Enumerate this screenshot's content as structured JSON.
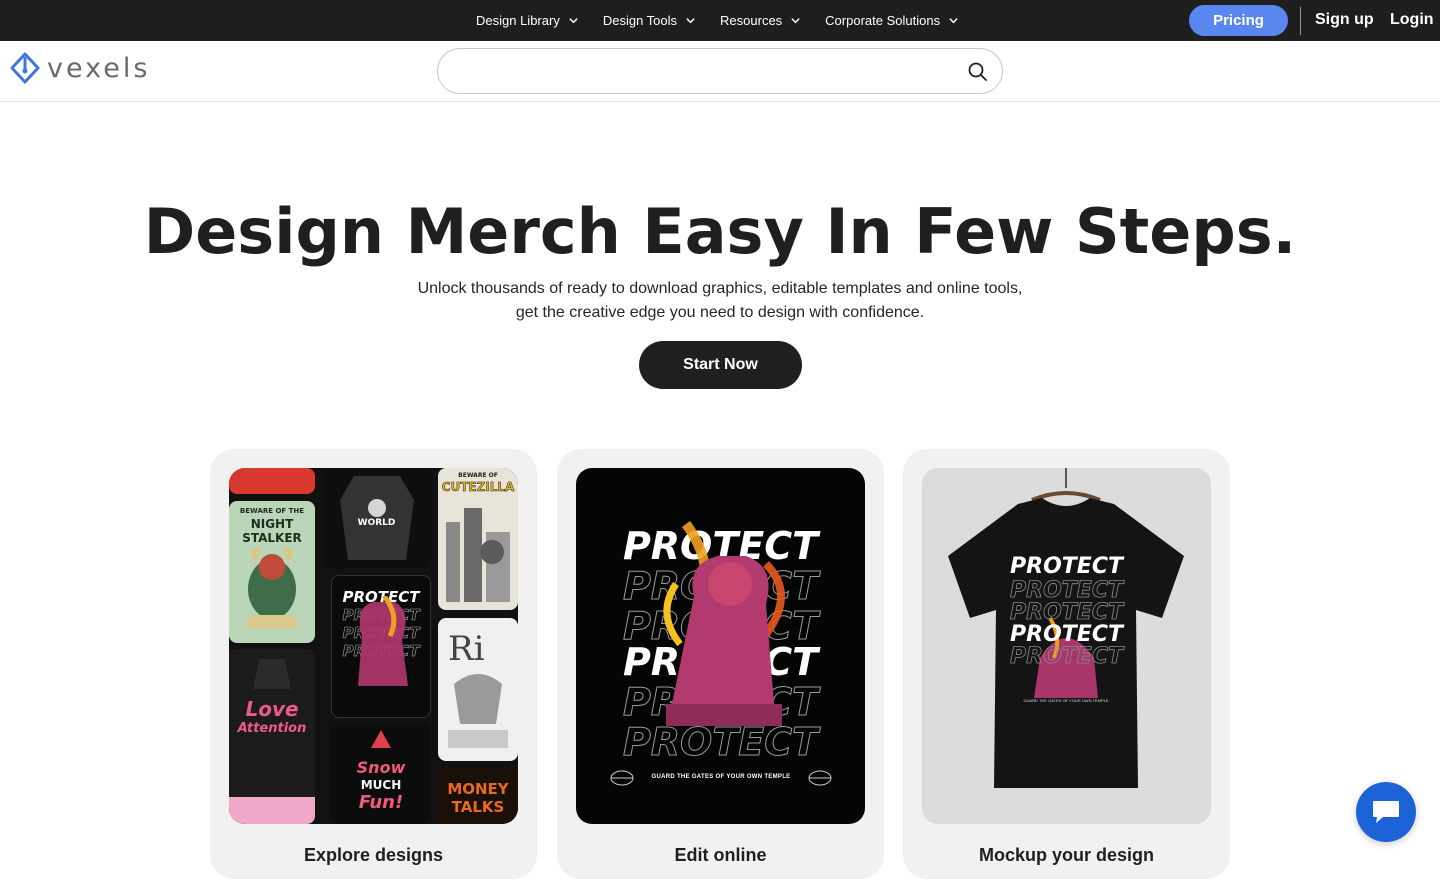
{
  "topbar": {
    "nav": [
      {
        "label": "Design Library"
      },
      {
        "label": "Design Tools"
      },
      {
        "label": "Resources"
      },
      {
        "label": "Corporate Solutions"
      }
    ],
    "pricing_label": "Pricing",
    "signup_label": "Sign up",
    "login_label": "Login"
  },
  "header": {
    "logo_text": "vexels",
    "search": {
      "value": "",
      "placeholder": ""
    }
  },
  "hero": {
    "title": "Design Merch Easy In Few Steps.",
    "subtitle_line1": "Unlock thousands of ready to download graphics, editable templates and online tools,",
    "subtitle_line2": "get the creative edge you need to design with confidence.",
    "cta_label": "Start Now"
  },
  "cards": [
    {
      "title": "Explore designs",
      "collage_texts": {
        "beware1": "BEWARE OF THE",
        "stalker": "NIGHT STALKER",
        "world": "WORLD",
        "beware2": "BEWARE OF",
        "cutezilla": "CUTEZILLA",
        "protect": "PROTECT",
        "love": "Love",
        "attention": "Attention",
        "snow": "Snow",
        "much": "MUCH",
        "fun": "Fun!",
        "money": "MONEY TALKS"
      }
    },
    {
      "title": "Edit online",
      "protect_word": "PROTECT",
      "tagline": "GUARD THE GATES OF YOUR OWN TEMPLE"
    },
    {
      "title": "Mockup your design",
      "protect_word": "PROTECT",
      "tagline": "GUARD THE GATES OF YOUR OWN TEMPLE"
    }
  ],
  "colors": {
    "topbar_bg": "#1e1e1e",
    "pricing_bg": "#5a86f0",
    "cta_bg": "#1f1f1f",
    "card_bg": "#f1f1f1",
    "chat_bg": "#1d63d8",
    "logo_blue": "#3c78e0"
  },
  "icons": {
    "search": "search-icon",
    "chevron": "chevron-down-icon",
    "chat": "chat-icon"
  }
}
